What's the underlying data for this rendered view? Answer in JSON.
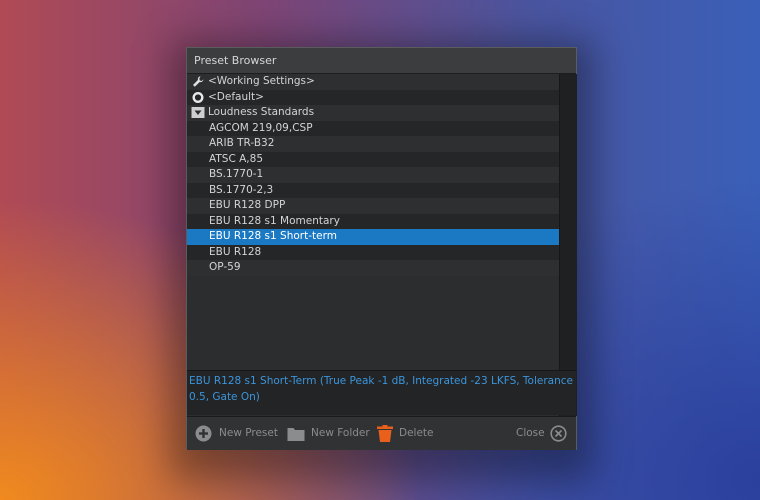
{
  "window": {
    "title": "Preset Browser"
  },
  "tree": {
    "working_settings": "<Working Settings>",
    "default": "<Default>",
    "folder": "Loudness Standards",
    "items": [
      "AGCOM 219,09,CSP",
      "ARIB TR-B32",
      "ATSC A,85",
      "BS.1770-1",
      "BS.1770-2,3",
      "EBU R128 DPP",
      "EBU R128 s1 Momentary",
      "EBU R128 s1 Short-term",
      "EBU R128",
      "OP-59"
    ],
    "selected_index": 7
  },
  "description": "EBU R128 s1 Short-Term (True Peak -1 dB, Integrated -23 LKFS, Tolerance 0.5, Gate On)",
  "footer": {
    "new_preset": "New Preset",
    "new_folder": "New Folder",
    "delete": "Delete",
    "close": "Close"
  },
  "colors": {
    "selection": "#1b79c4",
    "description_text": "#3b95dc",
    "delete_icon": "#e8601c"
  }
}
